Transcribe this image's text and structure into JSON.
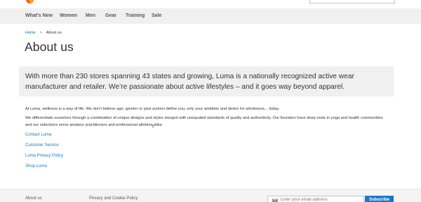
{
  "nav": {
    "items": [
      {
        "label": "What's New"
      },
      {
        "label": "Women"
      },
      {
        "label": "Men"
      },
      {
        "label": "Gear"
      },
      {
        "label": "Training"
      },
      {
        "label": "Sale"
      }
    ]
  },
  "breadcrumb": {
    "home": "Home",
    "separator": ">",
    "current": "About us"
  },
  "page": {
    "title": "About us",
    "intro": "With more than 230 stores spanning 43 states and growing, Luma is a nationally recognized active wear manufacturer and retailer. We’re passionate about active lifestyles – and it goes way beyond apparel.",
    "paragraphs": [
      "At Luma, wellness is a way of life. We don’t believe age, gender or past actions define you, only your ambition and desire for wholeness... today.",
      "We differentiate ourselves through a combination of unique designs and styles merged with unequaled standards of quality and authenticity. Our founders have deep roots in yoga and health communities and our selections serve amateur practitioners and professional athletes alike."
    ],
    "links": [
      {
        "label": "Contact Luma"
      },
      {
        "label": "Customer Service"
      },
      {
        "label": "Luma Privacy Policy"
      },
      {
        "label": "Shop Luma"
      }
    ]
  },
  "footer": {
    "links": [
      {
        "label": "About us"
      },
      {
        "label": "Privacy and Cookie Policy"
      }
    ],
    "newsletter": {
      "placeholder": "Enter your email address",
      "button_label": "Subscribe"
    }
  },
  "colors": {
    "accent": "#1979c3",
    "nav_bg": "#f0f0f0",
    "logo": "#f26322"
  },
  "icons": {
    "logo": "luma-logo-icon",
    "mail": "mail-icon",
    "cursor": "text-cursor-icon"
  }
}
